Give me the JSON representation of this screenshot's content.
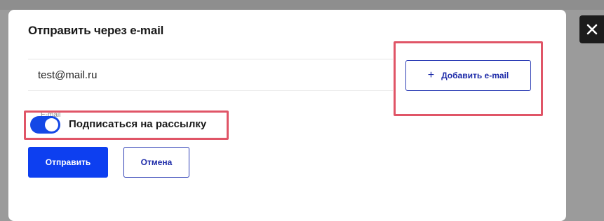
{
  "dialog": {
    "title": "Отправить через e-mail",
    "email": {
      "label": "E-mail",
      "value": "test@mail.ru"
    },
    "add_email_button": {
      "icon": "plus-icon",
      "label": "Добавить e-mail"
    },
    "subscribe_toggle": {
      "label": "Подписаться на рассылку",
      "checked": true,
      "color": "#1448e6"
    },
    "send_button": {
      "label": "Отправить",
      "color": "#0d3ff0"
    },
    "cancel_button": {
      "label": "Отмена"
    },
    "close_button": {
      "icon": "close-icon"
    }
  },
  "annotation_color": "#e05567"
}
